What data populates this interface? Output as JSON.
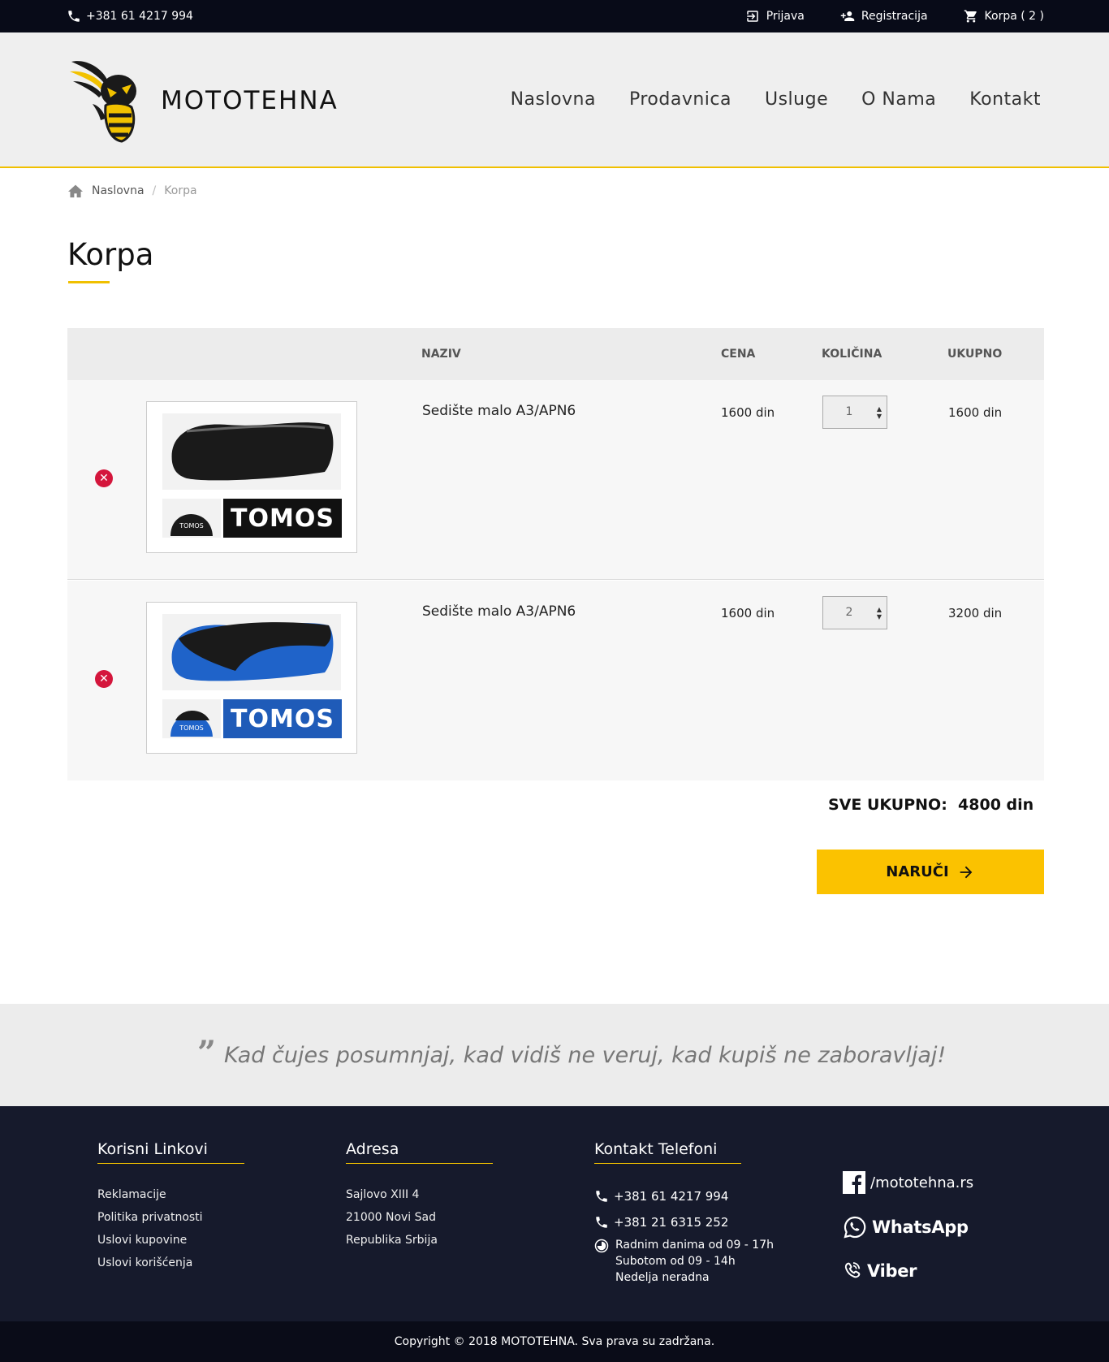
{
  "topbar": {
    "phone": "+381 61 4217 994",
    "login": "Prijava",
    "register": "Registracija",
    "cart": "Korpa ( 2 )"
  },
  "header": {
    "brand": "MOTOTEHNA",
    "nav": [
      "Naslovna",
      "Prodavnica",
      "Usluge",
      "O Nama",
      "Kontakt"
    ]
  },
  "breadcrumb": {
    "home": "Naslovna",
    "separator": "/",
    "current": "Korpa"
  },
  "page_title": "Korpa",
  "cart": {
    "columns": [
      "NAZIV",
      "CENA",
      "KOLIČINA",
      "UKUPNO"
    ],
    "items": [
      {
        "name": "Sedište malo A3/APN6",
        "price": "1600 din",
        "qty": "1",
        "total": "1600 din",
        "image_brand": "TOMOS",
        "seat_color": "#1a1a1a",
        "brand_bg": "#111111"
      },
      {
        "name": "Sedište malo A3/APN6",
        "price": "1600 din",
        "qty": "2",
        "total": "3200 din",
        "image_brand": "TOMOS",
        "seat_color": "#1f63c9",
        "brand_bg": "#1f5bb8"
      }
    ],
    "grand_total_label": "SVE UKUPNO:",
    "grand_total": "4800 din",
    "order_button": "NARUČI"
  },
  "quote": "Kad čujes posumnjaj, kad vidiš ne veruj, kad kupiš ne zaboravljaj!",
  "footer": {
    "links_title": "Korisni Linkovi",
    "links": [
      "Reklamacije",
      "Politika privatnosti",
      "Uslovi kupovine",
      "Uslovi korišćenja"
    ],
    "address_title": "Adresa",
    "address": [
      "Sajlovo XIII 4",
      "21000 Novi Sad",
      "Republika Srbija"
    ],
    "phones_title": "Kontakt Telefoni",
    "phones": [
      "+381 61 4217 994",
      "+381 21 6315 252"
    ],
    "hours": [
      "Radnim danima od 09 - 17h",
      "Subotom od 09 - 14h",
      "Nedelja neradna"
    ],
    "facebook": "/mototehna.rs",
    "whatsapp": "WhatsApp",
    "viber": "Viber",
    "copyright": "Copyright © 2018 MOTOTEHNA. Sva prava su zadržana."
  },
  "colors": {
    "accent": "#fbc200",
    "dark": "#161a2c",
    "remove": "#d4163c"
  }
}
